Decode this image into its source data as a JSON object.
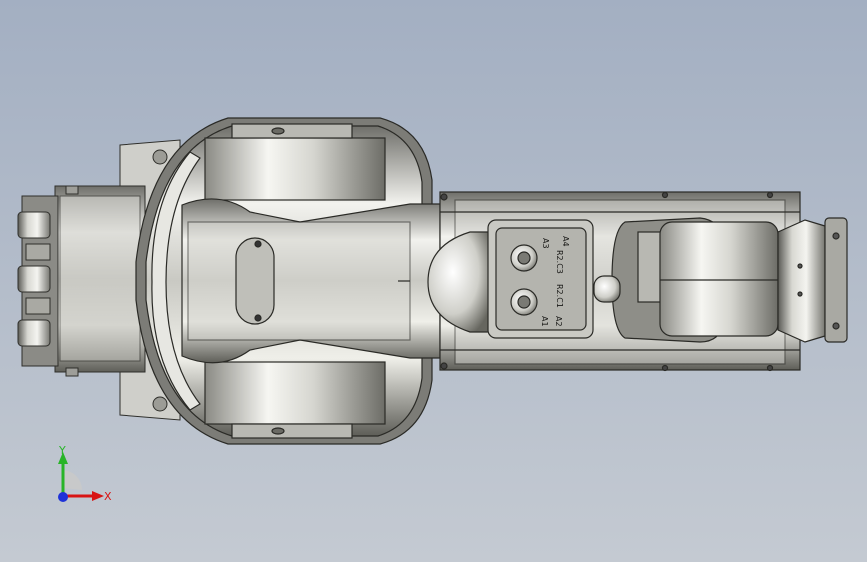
{
  "viewport": {
    "background_top": "#a3afc2",
    "background_bottom": "#c4cad2"
  },
  "part_labels": {
    "a1": "A1",
    "a2": "A2",
    "a3": "A3",
    "a4": "A4",
    "r2c1": "R2.C1",
    "r2c3": "R2.C3"
  },
  "triad": {
    "x_label": "X",
    "y_label": "Y",
    "x_color": "#d81414",
    "y_color": "#28b428",
    "z_color": "#1e32d8"
  }
}
